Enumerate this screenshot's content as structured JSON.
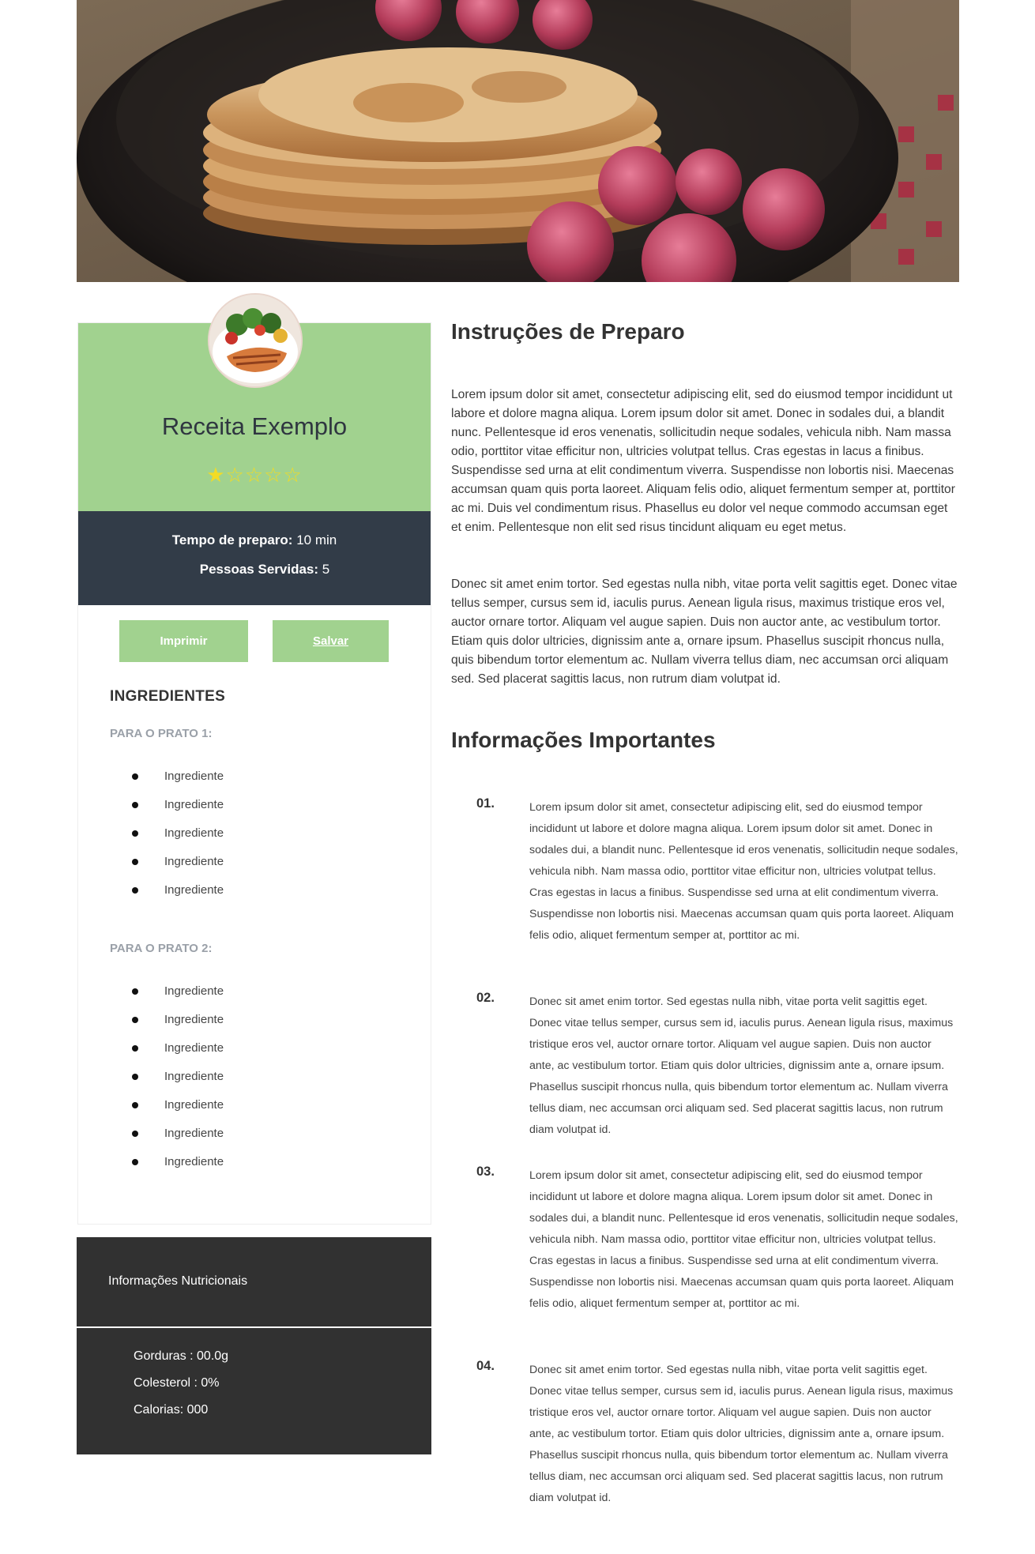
{
  "recipe": {
    "title": "Receita Exemplo",
    "rating_stars": "★☆☆☆☆",
    "rating_value": 1,
    "rating_max": 5,
    "prep_label": "Tempo de preparo:",
    "prep_value": " 10 min",
    "serves_label": "Pessoas Servidas:",
    "serves_value": " 5"
  },
  "buttons": {
    "print_label": "Imprimir",
    "save_label": "Salvar"
  },
  "ingredients": {
    "heading": "INGREDIENTES",
    "groups": [
      {
        "title": "PARA O PRATO 1:",
        "items": [
          "Ingrediente",
          "Ingrediente",
          "Ingrediente",
          "Ingrediente",
          "Ingrediente"
        ]
      },
      {
        "title": "PARA O PRATO 2:",
        "items": [
          "Ingrediente",
          "Ingrediente",
          "Ingrediente",
          "Ingrediente",
          "Ingrediente",
          "Ingrediente",
          "Ingrediente"
        ]
      }
    ]
  },
  "nutrition": {
    "heading": "Informações Nutricionais",
    "items": [
      "Gorduras : 00.0g",
      "Colesterol : 0%",
      "Calorias: 000"
    ]
  },
  "instructions": {
    "title": "Instruções de Preparo",
    "paragraphs": [
      "Lorem ipsum dolor sit amet, consectetur adipiscing elit, sed do eiusmod tempor incididunt ut labore et dolore magna aliqua. Lorem ipsum dolor sit amet. Donec in sodales dui, a blandit nunc. Pellentesque id eros venenatis, sollicitudin neque sodales, vehicula nibh. Nam massa odio, porttitor vitae efficitur non, ultricies volutpat tellus. Cras egestas in lacus a finibus. Suspendisse sed urna at elit condimentum viverra. Suspendisse non lobortis nisi. Maecenas accumsan quam quis porta laoreet. Aliquam felis odio, aliquet fermentum semper at, porttitor ac mi. Duis vel condimentum risus. Phasellus eu dolor vel neque commodo accumsan eget et enim. Pellentesque non elit sed risus tincidunt aliquam eu eget metus.",
      "Donec sit amet enim tortor. Sed egestas nulla nibh, vitae porta velit sagittis eget. Donec vitae tellus semper, cursus sem id, iaculis purus. Aenean ligula risus, maximus tristique eros vel, auctor ornare tortor. Aliquam vel augue sapien. Duis non auctor ante, ac vestibulum tortor. Etiam quis dolor ultricies, dignissim ante a, ornare ipsum. Phasellus suscipit rhoncus nulla, quis bibendum tortor elementum ac. Nullam viverra tellus diam, nec accumsan orci aliquam sed. Sed placerat sagittis lacus, non rutrum diam volutpat id."
    ]
  },
  "important_info": {
    "title": "Informações Importantes",
    "items": [
      {
        "number": "01.",
        "text": "Lorem ipsum dolor sit amet, consectetur adipiscing elit, sed do eiusmod tempor incididunt ut labore et dolore magna aliqua. Lorem ipsum dolor sit amet. Donec in sodales dui, a blandit nunc. Pellentesque id eros venenatis, sollicitudin neque sodales, vehicula nibh. Nam massa odio, porttitor vitae efficitur non, ultricies volutpat tellus. Cras egestas in lacus a finibus. Suspendisse sed urna at elit condimentum viverra. Suspendisse non lobortis nisi. Maecenas accumsan quam quis porta laoreet. Aliquam felis odio, aliquet fermentum semper at, porttitor ac mi."
      },
      {
        "number": "02.",
        "text": "Donec sit amet enim tortor. Sed egestas nulla nibh, vitae porta velit sagittis eget. Donec vitae tellus semper, cursus sem id, iaculis purus. Aenean ligula risus, maximus tristique eros vel, auctor ornare tortor. Aliquam vel augue sapien. Duis non auctor ante, ac vestibulum tortor. Etiam quis dolor ultricies, dignissim ante a, ornare ipsum. Phasellus suscipit rhoncus nulla, quis bibendum tortor elementum ac. Nullam viverra tellus diam, nec accumsan orci aliquam sed. Sed placerat sagittis lacus, non rutrum diam volutpat id."
      },
      {
        "number": "03.",
        "text": "Lorem ipsum dolor sit amet, consectetur adipiscing elit, sed do eiusmod tempor incididunt ut labore et dolore magna aliqua. Lorem ipsum dolor sit amet. Donec in sodales dui, a blandit nunc. Pellentesque id eros venenatis, sollicitudin neque sodales, vehicula nibh. Nam massa odio, porttitor vitae efficitur non, ultricies volutpat tellus. Cras egestas in lacus a finibus. Suspendisse sed urna at elit condimentum viverra. Suspendisse non lobortis nisi. Maecenas accumsan quam quis porta laoreet. Aliquam felis odio, aliquet fermentum semper at, porttitor ac mi."
      },
      {
        "number": "04.",
        "text": "Donec sit amet enim tortor. Sed egestas nulla nibh, vitae porta velit sagittis eget. Donec vitae tellus semper, cursus sem id, iaculis purus. Aenean ligula risus, maximus tristique eros vel, auctor ornare tortor. Aliquam vel augue sapien. Duis non auctor ante, ac vestibulum tortor. Etiam quis dolor ultricies, dignissim ante a, ornare ipsum. Phasellus suscipit rhoncus nulla, quis bibendum tortor elementum ac. Nullam viverra tellus diam, nec accumsan orci aliquam sed. Sed placerat sagittis lacus, non rutrum diam volutpat id."
      }
    ]
  },
  "colors": {
    "accent_green": "#a1d28f",
    "meta_dark": "#323c48",
    "nutrition_dark": "#313131",
    "star_yellow": "#f2dc25"
  },
  "icons": {
    "hero": "pancakes-raspberries-photo",
    "avatar": "salmon-salad-dish-photo",
    "bullet": "bullet-dot-icon"
  }
}
